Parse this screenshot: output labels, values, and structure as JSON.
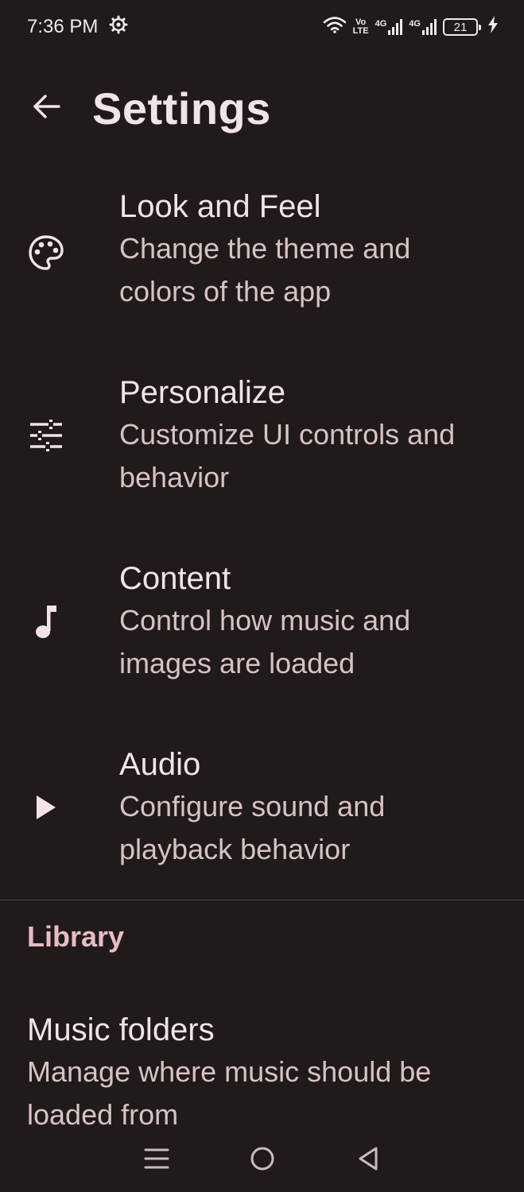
{
  "status_bar": {
    "time": "7:36 PM",
    "volte_top": "Vo",
    "volte_bottom": "LTE",
    "network_1": "4G",
    "network_2": "4G",
    "battery_level": "21"
  },
  "app_bar": {
    "title": "Settings"
  },
  "settings": [
    {
      "title": "Look and Feel",
      "subtitle": "Change the theme and colors of the app",
      "icon": "palette-icon"
    },
    {
      "title": "Personalize",
      "subtitle": "Customize UI controls and behavior",
      "icon": "tune-icon"
    },
    {
      "title": "Content",
      "subtitle": "Control how music and images are loaded",
      "icon": "music-note-icon"
    },
    {
      "title": "Audio",
      "subtitle": "Configure sound and playback behavior",
      "icon": "play-icon"
    }
  ],
  "library": {
    "header": "Library",
    "music_folders": {
      "title": "Music folders",
      "subtitle": "Manage where music should be loaded from"
    }
  },
  "colors": {
    "background": "#201a1b",
    "text_primary": "#f2e4e4",
    "text_secondary": "#d8c2c2",
    "accent": "#e8bcc4"
  }
}
